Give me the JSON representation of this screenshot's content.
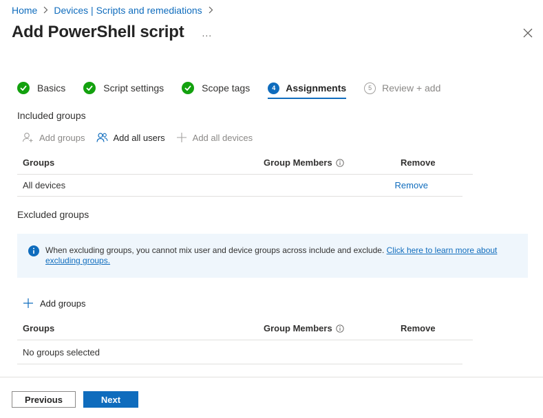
{
  "breadcrumb": {
    "home": "Home",
    "devices": "Devices | Scripts and remediations"
  },
  "page_title": "Add PowerShell script",
  "more_label": "...",
  "steps": [
    {
      "label": "Basics",
      "state": "complete"
    },
    {
      "label": "Script settings",
      "state": "complete"
    },
    {
      "label": "Scope tags",
      "state": "complete"
    },
    {
      "number": "4",
      "label": "Assignments",
      "state": "active"
    },
    {
      "number": "5",
      "label": "Review + add",
      "state": "pending"
    }
  ],
  "included": {
    "title": "Included groups",
    "commands": {
      "add_groups": "Add groups",
      "add_all_users": "Add all users",
      "add_all_devices": "Add all devices"
    },
    "columns": {
      "groups": "Groups",
      "members": "Group Members",
      "remove": "Remove"
    },
    "rows": [
      {
        "group": "All devices",
        "remove": "Remove"
      }
    ]
  },
  "excluded": {
    "title": "Excluded groups",
    "banner_text": "When excluding groups, you cannot mix user and device groups across include and exclude. ",
    "banner_link": "Click here to learn more about excluding groups.",
    "add_groups": "Add groups",
    "columns": {
      "groups": "Groups",
      "members": "Group Members",
      "remove": "Remove"
    },
    "empty": "No groups selected"
  },
  "footer": {
    "previous": "Previous",
    "next": "Next"
  },
  "colors": {
    "accent": "#0f6cbd",
    "success": "#13a10e",
    "banner_bg": "#eff6fc"
  }
}
